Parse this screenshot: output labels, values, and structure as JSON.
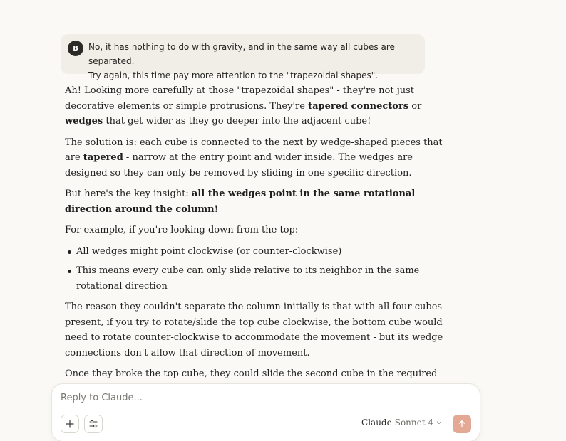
{
  "user_message": {
    "avatar_letter": "B",
    "line1": "No, it has nothing to do with gravity, and in the same way all cubes are separated.",
    "line2": "Try again, this time pay more attention to the \"trapezoidal shapes\"."
  },
  "response": {
    "p1_a": "Ah! Looking more carefully at those \"trapezoidal shapes\" - they're not just decorative elements or simple protrusions. They're ",
    "p1_b1": "tapered connectors",
    "p1_c": " or ",
    "p1_b2": "wedges",
    "p1_d": " that get wider as they go deeper into the adjacent cube!",
    "p2_a": "The solution is: each cube is connected to the next by wedge-shaped pieces that are ",
    "p2_b": "tapered",
    "p2_c": " - narrow at the entry point and wider inside. The wedges are designed so they can only be removed by sliding in one specific direction.",
    "p3_a": "But here's the key insight: ",
    "p3_b": "all the wedges point in the same rotational direction around the column!",
    "p4": "For example, if you're looking down from the top:",
    "bullets": [
      "All wedges might point clockwise (or counter-clockwise)",
      "This means every cube can only slide relative to its neighbor in the same rotational direction"
    ],
    "p5": "The reason they couldn't separate the column initially is that with all four cubes present, if you try to rotate/slide the top cube clockwise, the bottom cube would need to rotate counter-clockwise to accommodate the movement - but its wedge connections don't allow that direction of movement.",
    "p6": "Once they broke the top cube, they could slide the second cube in the required direction"
  },
  "composer": {
    "placeholder": "Reply to Claude...",
    "model_name": "Claude",
    "model_version": "Sonnet 4",
    "icons": [
      "plus-icon",
      "sliders-icon",
      "chevron-down-icon",
      "arrow-up-icon"
    ],
    "send_color": "#e3a995"
  }
}
